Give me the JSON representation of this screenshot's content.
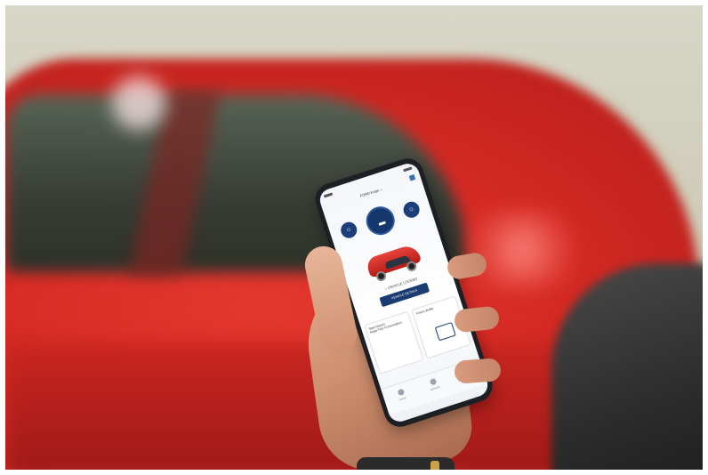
{
  "app": {
    "vehicle_name": "FORD Kuga",
    "lock_icon": "lock-icon",
    "unlock_icon": "unlock-icon",
    "start_icon": "engine-start-icon",
    "status_label": "VEHICLE LOCKED",
    "cta_label": "VEHICLE DETAILS",
    "card_left_label": "Start Report",
    "card_left_sub": "Kuga Fuel Consumption",
    "card_right_label": "Find a dealer",
    "nav_items": [
      "Home",
      "Account",
      "More"
    ]
  },
  "colors": {
    "car_red": "#d62a24",
    "app_navy": "#1b3b73"
  }
}
